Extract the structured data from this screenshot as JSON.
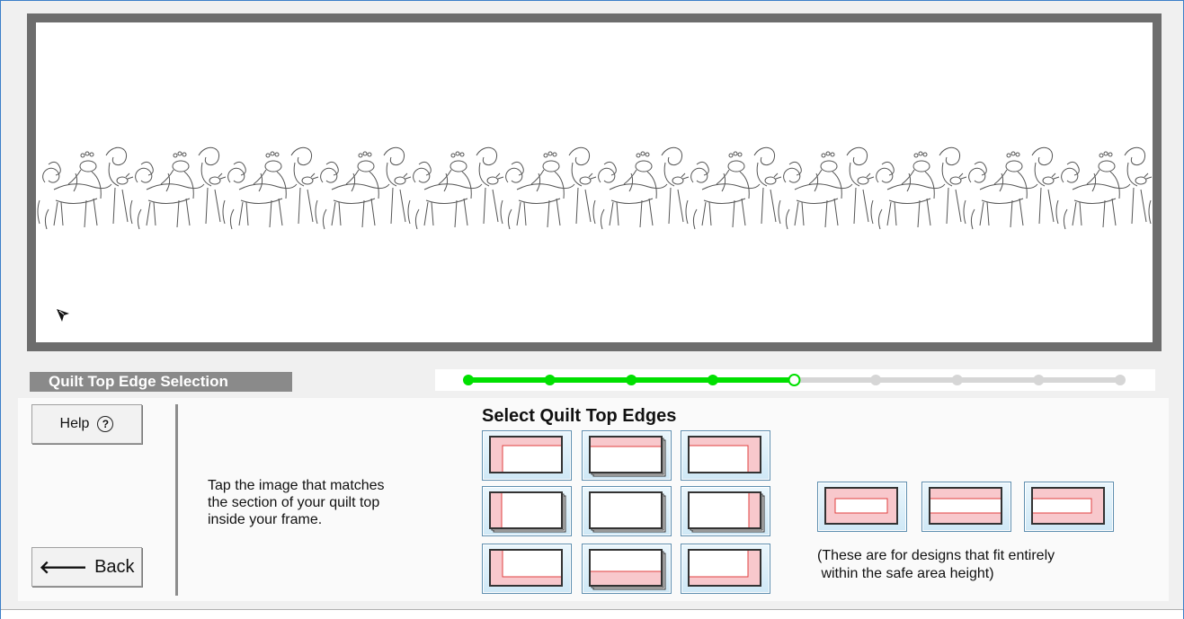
{
  "section": {
    "title": "Quilt Top Edge Selection"
  },
  "progress": {
    "total_steps": 9,
    "completed_steps": 4,
    "current_step": 5,
    "active_color": "#00e000",
    "inactive_color": "#d6d6d6"
  },
  "buttons": {
    "help_label": "Help",
    "back_label": "Back"
  },
  "icons": {
    "help": "question-circle-icon",
    "back": "left-arrow-icon",
    "cursor": "pointer-arrow-icon"
  },
  "instructions": {
    "line1": "Tap the image that matches",
    "line2": "the section of your quilt top",
    "line3": "inside your frame."
  },
  "edge_grid": {
    "title": "Select Quilt Top Edges",
    "tiles": [
      {
        "name": "top-left-edge"
      },
      {
        "name": "top-edge"
      },
      {
        "name": "top-right-edge"
      },
      {
        "name": "left-edge"
      },
      {
        "name": "center"
      },
      {
        "name": "right-edge"
      },
      {
        "name": "bottom-left-edge"
      },
      {
        "name": "bottom-edge"
      },
      {
        "name": "bottom-right-edge"
      }
    ]
  },
  "safe_area_tiles": [
    {
      "name": "all-edges"
    },
    {
      "name": "top-bottom-edges"
    },
    {
      "name": "left-right-top-bottom-edges"
    }
  ],
  "note": {
    "line1": "(These are for designs that fit entirely",
    "line2": " within the safe area height)"
  },
  "colors": {
    "edge_fill": "#f8c8cc",
    "edge_line": "#e04040",
    "tile_bg": "#d8eef9"
  }
}
